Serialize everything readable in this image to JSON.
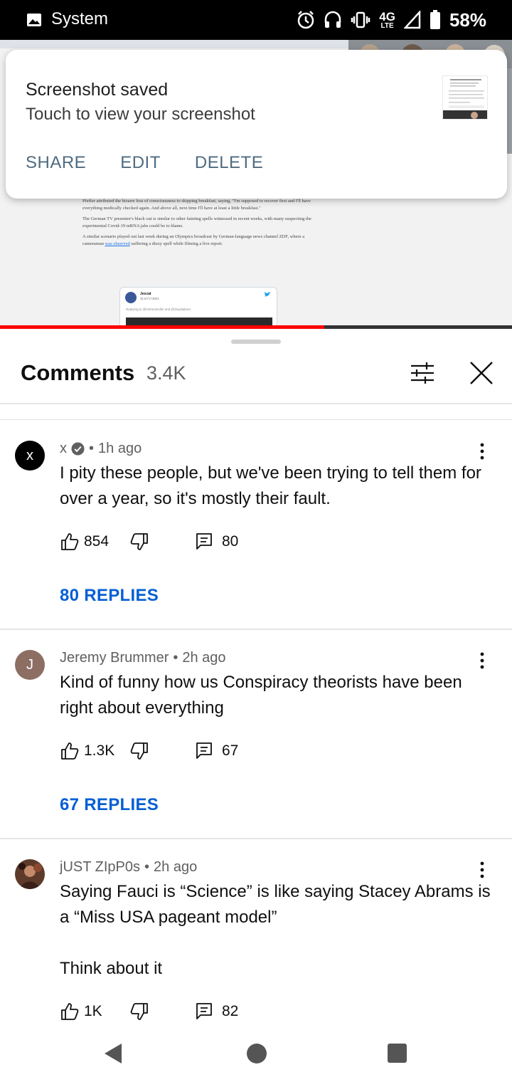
{
  "status_bar": {
    "app_label": "System",
    "network": "4G",
    "network_sub": "LTE",
    "battery": "58%"
  },
  "background_article": {
    "paragraph_1": "Pfeffer attributed the bizarre loss of consciousness to skipping breakfast, saying, \"I'm supposed to recover first and I'll have everything medically checked again. And above all, next time I'll have at least a little breakfast.\"",
    "paragraph_2": "The German TV presenter's black out is similar to other fainting spells witnessed in recent weeks, with many suspecting the experimental Covid-19 mRNA jabs could be to blame.",
    "paragraph_3_start": "A similar scenario played out last week during an Olympics broadcast by German-language news channel ZDF, where a cameraman ",
    "paragraph_3_link": "was observed",
    "paragraph_3_end": " suffering a dizzy spell while filming a live report.",
    "tweet_name": "Jescat",
    "tweet_handle": "@J47173801",
    "tweet_reply": "Replying to @holmenkollin and @claudiabest"
  },
  "video_progress": 0.633,
  "notification": {
    "title": "Screenshot saved",
    "subtitle": "Touch to view your screenshot",
    "actions": [
      "SHARE",
      "EDIT",
      "DELETE"
    ]
  },
  "comments_panel": {
    "title": "Comments",
    "count": "3.4K"
  },
  "comments": [
    {
      "author": "x",
      "verified": true,
      "time": "1h ago",
      "avatar_letter": "x",
      "avatar_color": "#000000",
      "text": "I pity these people, but we've been trying to tell them for over a year, so it's mostly their fault.",
      "likes": "854",
      "reply_count": "80",
      "replies_label": "80 REPLIES"
    },
    {
      "author": "Jeremy Brummer",
      "verified": false,
      "time": "2h ago",
      "avatar_letter": "J",
      "avatar_color": "#8d6e63",
      "text": "Kind of funny how us Conspiracy theorists have been right about everything",
      "likes": "1.3K",
      "reply_count": "67",
      "replies_label": "67 REPLIES"
    },
    {
      "author": "jUST ZIpP0s",
      "verified": false,
      "time": "2h ago",
      "avatar_letter": "",
      "avatar_color": "#5d3a2a",
      "text": "Saying Fauci is “Science” is like saying Stacey Abrams is a “Miss USA pageant model”\n\nThink about it",
      "likes": "1K",
      "reply_count": "82"
    }
  ],
  "meta_separator": "•",
  "colors": {
    "link_blue": "#065fd4",
    "progress_red": "#ff0000",
    "notification_action": "#4f6b80"
  }
}
